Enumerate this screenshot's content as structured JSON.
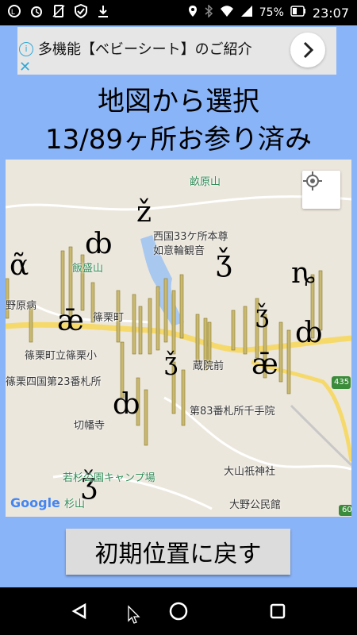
{
  "status_bar": {
    "battery": "75%",
    "time": "23:07",
    "left_icons": [
      "launcher-icon",
      "alarm-icon",
      "no-sim-icon",
      "shield-check-icon",
      "download-icon"
    ],
    "right_icons": [
      "location-icon",
      "bluetooth-icon",
      "wifi-icon",
      "signal-icon",
      "battery-icon"
    ]
  },
  "ad": {
    "text": "多機能【ベビーシート】のご紹介",
    "info_icon": "info-icon",
    "close_glyph": "✕",
    "arrow_icon": "chevron-right-icon"
  },
  "header": {
    "title": "地図から選択",
    "subtitle": "13/89ヶ所お参り済み"
  },
  "map": {
    "labels": [
      {
        "text": "畝原山",
        "cls": "green"
      },
      {
        "text": "西国33ケ所本尊"
      },
      {
        "text": "如意輪観音"
      },
      {
        "text": "飯盛山",
        "cls": "green"
      },
      {
        "text": "野原病"
      },
      {
        "text": "篠栗町"
      },
      {
        "text": "篠栗町立篠栗小"
      },
      {
        "text": "篠栗四国第23番札所"
      },
      {
        "text": "蔵院前"
      },
      {
        "text": "第83番札所千手院"
      },
      {
        "text": "切幡寺"
      },
      {
        "text": "大山祇神社"
      },
      {
        "text": "若杉公園キャンプ場",
        "cls": "green"
      },
      {
        "text": "杉山",
        "cls": "green"
      },
      {
        "text": "大野公民館"
      },
      {
        "text": "435"
      },
      {
        "text": "60"
      }
    ],
    "google": "Google",
    "locate_icon": "crosshair-icon"
  },
  "reset_button": "初期位置に戻す",
  "nav": {
    "back_icon": "back-triangle-icon",
    "home_icon": "home-circle-icon",
    "recents_icon": "recents-square-icon"
  },
  "colors": {
    "background": "#8ab4f8",
    "ad_bg": "#e6e6e6",
    "map_bg": "#ece7dc",
    "road_yellow": "#f6d96b",
    "pin_fill": "#c8b870",
    "water": "#a8c8f0"
  }
}
